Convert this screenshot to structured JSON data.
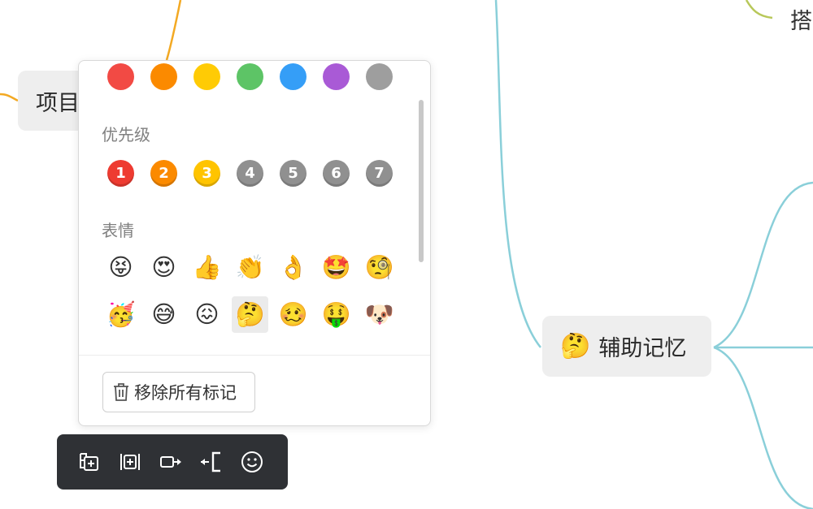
{
  "colors": {
    "palette": [
      "#f24a44",
      "#fb8a00",
      "#ffcb05",
      "#5dc466",
      "#359ef7",
      "#a95ad6",
      "#9e9e9e"
    ],
    "priority_colors": [
      "#ee3b31",
      "#fb8a00",
      "#ffc400",
      "#909090",
      "#909090",
      "#909090",
      "#909090"
    ],
    "line_orange": "#f3a923",
    "line_teal": "#8acfd9",
    "line_olive": "#b8c85a",
    "toolbar_bg": "#2f3135"
  },
  "mindmap": {
    "node_project": "项目",
    "node_memory_emoji": "🤔",
    "node_memory": "辅助记忆",
    "node_partial_right": "搭"
  },
  "panel": {
    "priority_label": "优先级",
    "priorities": [
      "1",
      "2",
      "3",
      "4",
      "5",
      "6",
      "7"
    ],
    "emoji_label": "表情",
    "emoji_row1": [
      "😝",
      "😍",
      "👍",
      "👏",
      "👌",
      "🤩",
      "🧐"
    ],
    "emoji_row2": [
      "🥳",
      "😅",
      "😖",
      "🤔",
      "🥴",
      "🤑",
      "🐶"
    ],
    "selected_emoji": "🤔",
    "remove_all_label": "移除所有标记"
  },
  "toolbar": {
    "icons": [
      "add-parent-node-icon",
      "add-sibling-node-icon",
      "add-child-node-icon",
      "add-summary-icon",
      "emoji-marker-icon"
    ]
  }
}
